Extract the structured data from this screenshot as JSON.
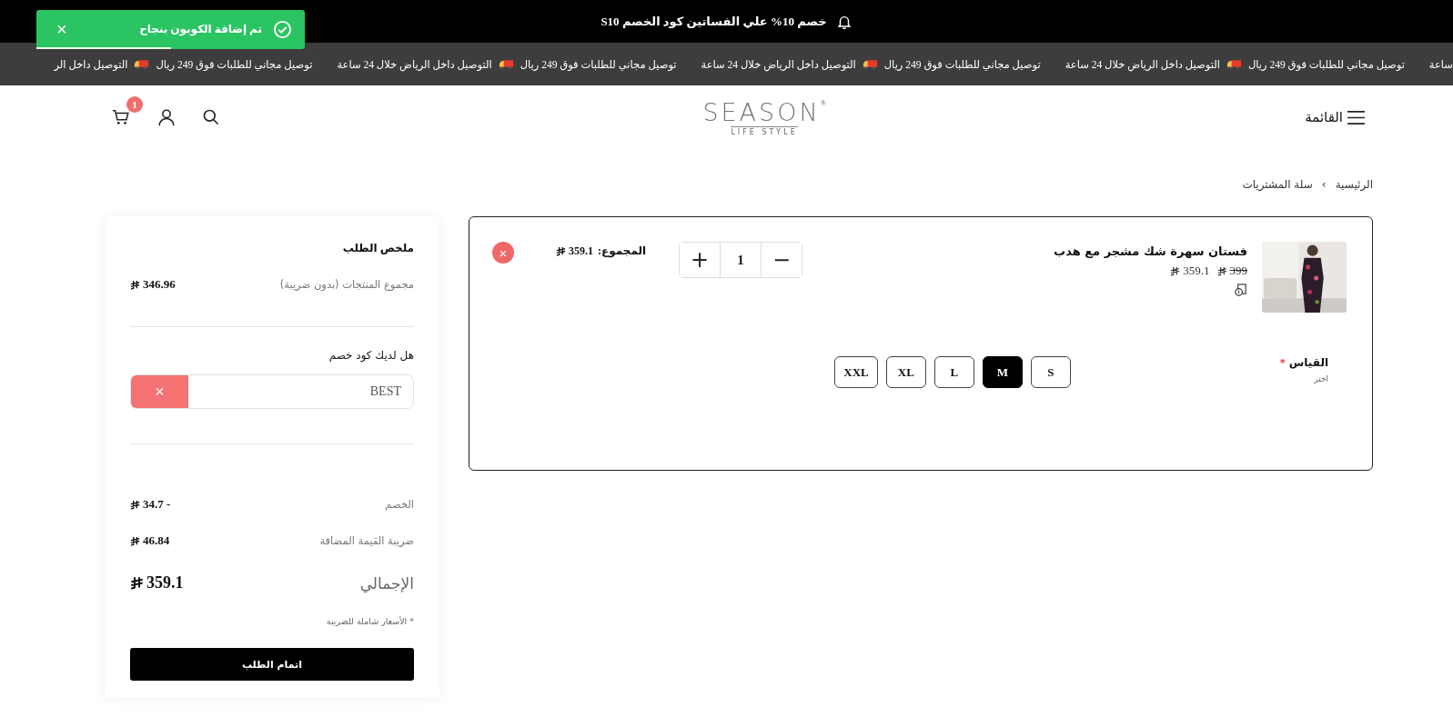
{
  "announcement": {
    "text": "خصم 10% علي الفساتين كود الخصم S10"
  },
  "toast": {
    "message": "تم إضافة الكوبون بنجاح",
    "close": "×",
    "level": 0.5
  },
  "ticker": [
    {
      "kind": "text",
      "text": "ساعة"
    },
    {
      "kind": "text",
      "text": "توصيل مجاني للطلبات فوق 249 ريال"
    },
    {
      "kind": "truck"
    },
    {
      "kind": "text",
      "text": "التوصيل داخل الرياض خلال 24 ساعة"
    },
    {
      "kind": "text",
      "text": "توصيل مجاني للطلبات فوق 249 ريال"
    },
    {
      "kind": "truck"
    },
    {
      "kind": "text",
      "text": "التوصيل داخل الرياض خلال 24 ساعة"
    },
    {
      "kind": "text",
      "text": "توصيل مجاني للطلبات فوق 249 ريال"
    },
    {
      "kind": "truck"
    },
    {
      "kind": "text",
      "text": "التوصيل داخل الرياض خلال 24 ساعة"
    },
    {
      "kind": "text",
      "text": "توصيل مجاني للطلبات فوق 249 ريال"
    },
    {
      "kind": "truck"
    },
    {
      "kind": "text",
      "text": "التوصيل داخل الر"
    }
  ],
  "header": {
    "menu_label": "القائمة",
    "logo": {
      "name": "SEASON",
      "tagline": "LIFE STYLE",
      "mark": "®"
    },
    "cart_count": "1"
  },
  "breadcrumb": {
    "items": [
      "الرئيسية",
      "سلة المشتريات"
    ],
    "separator": "›"
  },
  "cart": {
    "items": [
      {
        "name": "فستان سهرة شك مشجر مع هدب",
        "old_price": "399",
        "price": "359.1",
        "quantity": "1",
        "minus": "−",
        "plus": "+",
        "total_label": "المجموع:",
        "total": "359.1",
        "remove": "×",
        "option": {
          "label": "القياس",
          "required_mark": "*",
          "hint": "اختر",
          "choices": [
            {
              "label": "S",
              "selected": false
            },
            {
              "label": "M",
              "selected": true
            },
            {
              "label": "L",
              "selected": false
            },
            {
              "label": "XL",
              "selected": false
            },
            {
              "label": "XXL",
              "selected": false
            }
          ]
        }
      }
    ]
  },
  "summary": {
    "title": "ملخص الطلب",
    "subtotal": {
      "label": "مجموع المنتجات (بدون ضريبة)",
      "value": "346.96"
    },
    "coupon": {
      "question": "هل لديك كود خصم",
      "value": "BEST",
      "remove": "×"
    },
    "discount": {
      "label": "الخصم",
      "value": "34.7 -"
    },
    "vat": {
      "label": "ضريبة القيمة المضافة",
      "value": "46.84"
    },
    "total": {
      "label": "الإجمالي",
      "value": "359.1"
    },
    "note": "* الأسعار شاملة للضريبة",
    "checkout": "اتمام الطلب"
  }
}
